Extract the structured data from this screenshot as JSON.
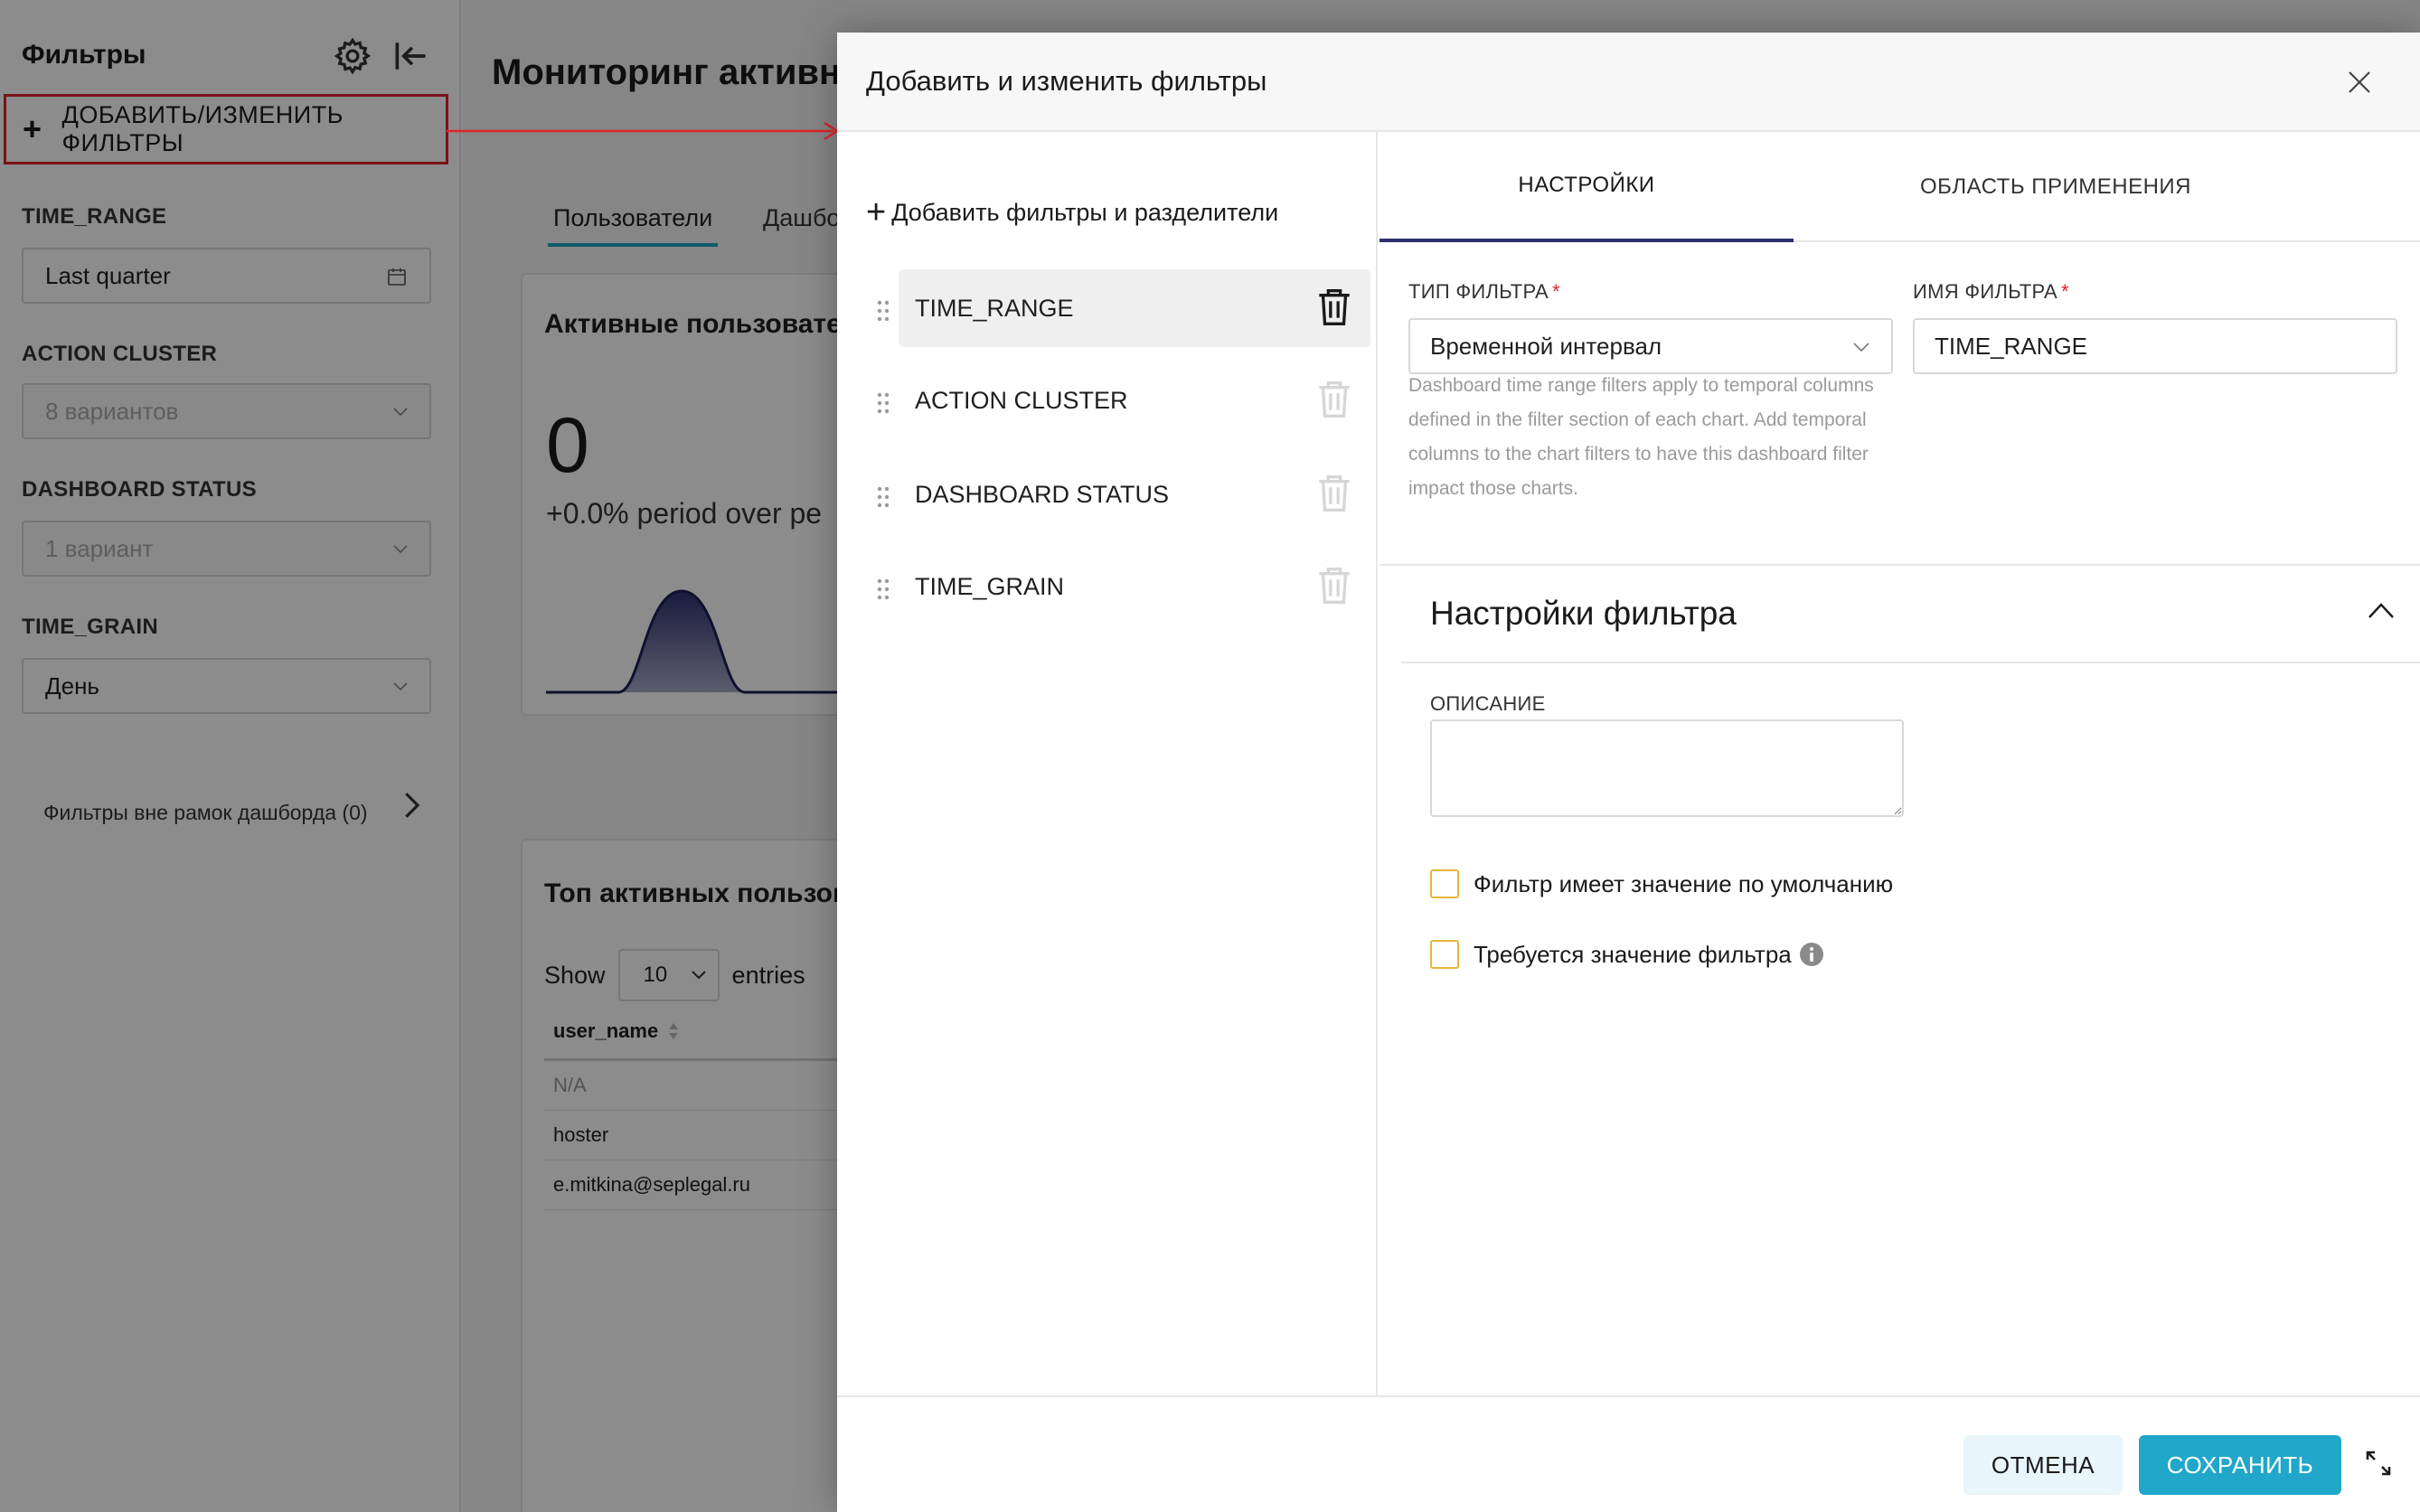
{
  "sidebar": {
    "title": "Фильтры",
    "add_button": "ДОБАВИТЬ/ИЗМЕНИТЬ ФИЛЬТРЫ",
    "filters": [
      {
        "label": "TIME_RANGE",
        "value": "Last quarter"
      },
      {
        "label": "ACTION CLUSTER",
        "value": "8 вариантов"
      },
      {
        "label": "DASHBOARD STATUS",
        "value": "1 вариант"
      },
      {
        "label": "TIME_GRAIN",
        "value": "День"
      }
    ],
    "out_of_scope": "Фильтры вне рамок дашборда (0)"
  },
  "main": {
    "title": "Мониторинг активно",
    "tabs": [
      "Пользователи",
      "Дашбо"
    ],
    "card1": {
      "title": "Активные пользовател",
      "big_number": "0",
      "period": "+0.0% period over pe"
    },
    "card2": {
      "title": "Топ активных пользов",
      "show_label": "Show",
      "show_value": "10",
      "entries_label": "entries",
      "column_header": "user_name",
      "rows": [
        "N/A",
        "hoster",
        "e.mitkina@seplegal.ru"
      ]
    }
  },
  "modal": {
    "title": "Добавить и изменить фильтры",
    "add_filters_label": "Добавить фильтры и разделители",
    "filter_list": [
      "TIME_RANGE",
      "ACTION CLUSTER",
      "DASHBOARD STATUS",
      "TIME_GRAIN"
    ],
    "tabs": [
      "НАСТРОЙКИ",
      "ОБЛАСТЬ ПРИМЕНЕНИЯ"
    ],
    "filter_type_label": "ТИП ФИЛЬТРА",
    "filter_type_value": "Временной интервал",
    "filter_name_label": "ИМЯ ФИЛЬТРА",
    "filter_name_value": "TIME_RANGE",
    "hint": "Dashboard time range filters apply to temporal columns defined in the filter section of each chart. Add temporal columns to the chart filters to have this dashboard filter impact those charts.",
    "section_title": "Настройки фильтра",
    "description_label": "ОПИСАНИЕ",
    "description_value": "",
    "checkbox_default": "Фильтр имеет значение по умолчанию",
    "checkbox_required": "Требуется значение фильтра",
    "cancel_label": "ОТМЕНА",
    "save_label": "СОХРАНИТЬ"
  },
  "colors": {
    "accent": "#20a7c9",
    "tab_active": "#2f2f6e",
    "highlight_red": "#e0222a",
    "checkbox_border": "#e8b53a"
  }
}
